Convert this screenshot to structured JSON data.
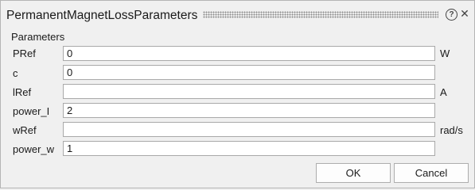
{
  "window": {
    "title": "PermanentMagnetLossParameters"
  },
  "section": {
    "label": "Parameters"
  },
  "params": [
    {
      "label": "PRef",
      "value": "0",
      "unit": "W"
    },
    {
      "label": "c",
      "value": "0",
      "unit": ""
    },
    {
      "label": "lRef",
      "value": "",
      "unit": "A"
    },
    {
      "label": "power_I",
      "value": "2",
      "unit": ""
    },
    {
      "label": "wRef",
      "value": "",
      "unit": "rad/s"
    },
    {
      "label": "power_w",
      "value": "1",
      "unit": ""
    }
  ],
  "buttons": {
    "ok": "OK",
    "cancel": "Cancel"
  },
  "icons": {
    "help": "help-icon",
    "close": "close-icon"
  }
}
